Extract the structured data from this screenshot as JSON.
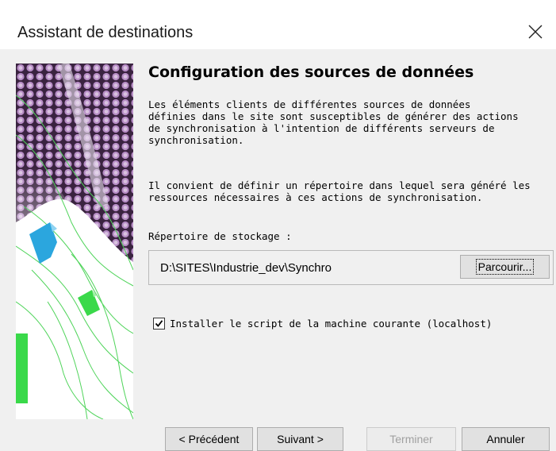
{
  "window": {
    "title": "Assistant de destinations",
    "close_icon": "close-icon"
  },
  "page": {
    "heading": "Configuration des sources de données",
    "paragraph1": "Les éléments clients de différentes sources de données\ndéfinies dans le site sont susceptibles de générer des actions\nde synchronisation à l'intention de différents serveurs de\nsynchronisation.",
    "paragraph2": "Il convient de définir un répertoire dans lequel sera généré les\nressources nécessaires à ces actions de synchronisation.",
    "storage_label": "Répertoire de stockage :",
    "storage_path": "D:\\SITES\\Industrie_dev\\Synchro",
    "browse_label": "Parcourir...",
    "checkbox_label": "Installer le script de la machine courante (localhost)",
    "checkbox_checked": true
  },
  "footer": {
    "previous_label": "< Précédent",
    "next_label": "Suivant >",
    "finish_label": "Terminer",
    "cancel_label": "Annuler",
    "finish_enabled": false
  },
  "colors": {
    "sidebar_purple": "#7a4a8c",
    "sidebar_blue": "#2ba6de",
    "sidebar_green": "#3ad94a"
  }
}
